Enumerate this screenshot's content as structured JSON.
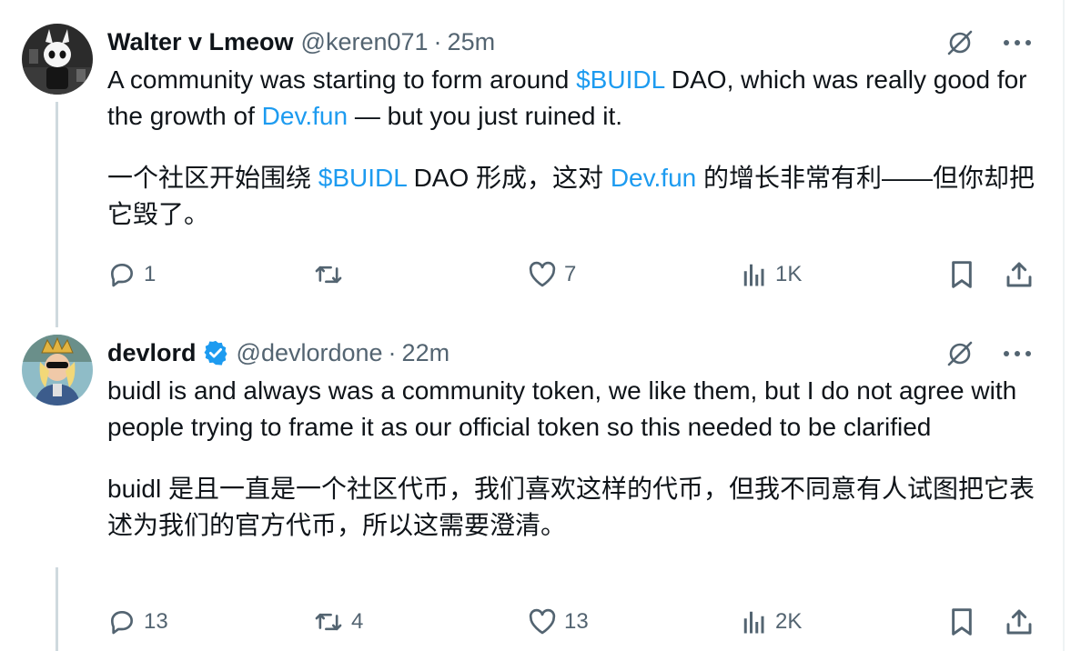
{
  "tweets": [
    {
      "author_name": "Walter v Lmeow",
      "handle": "@keren071",
      "separator": "·",
      "time": "25m",
      "verified": false,
      "text_en_segments": [
        "A community was starting to form around ",
        "$BUIDL",
        " DAO, which was really good for the growth of ",
        "Dev.fun",
        " — but you just ruined it."
      ],
      "text_zh_segments": [
        "一个社区开始围绕 ",
        "$BUIDL",
        " DAO 形成，这对 ",
        "Dev.fun",
        " 的增长非常有利——但你却把它毁了。"
      ],
      "stats": {
        "replies": "1",
        "reposts": "",
        "likes": "7",
        "views": "1K"
      }
    },
    {
      "author_name": "devlord",
      "handle": "@devlordone",
      "separator": "·",
      "time": "22m",
      "verified": true,
      "text_en": "buidl is and always was a community token, we like them, but I do not agree with people trying to frame it as our official token so this needed to be clarified",
      "text_zh": "buidl 是且一直是一个社区代币，我们喜欢这样的代币，但我不同意有人试图把它表述为我们的官方代币，所以这需要澄清。",
      "stats": {
        "replies": "13",
        "reposts": "4",
        "likes": "13",
        "views": "2K"
      }
    }
  ],
  "icons": {
    "header": [
      "grok-icon",
      "more-icon"
    ],
    "actions": [
      "reply-icon",
      "repost-icon",
      "like-icon",
      "views-icon",
      "bookmark-icon",
      "share-icon"
    ]
  },
  "colors": {
    "link": "#1d9bf0",
    "secondary_text": "#536471",
    "primary_text": "#0f1419",
    "verified": "#1d9bf0",
    "thread_line": "#cfd9de"
  }
}
